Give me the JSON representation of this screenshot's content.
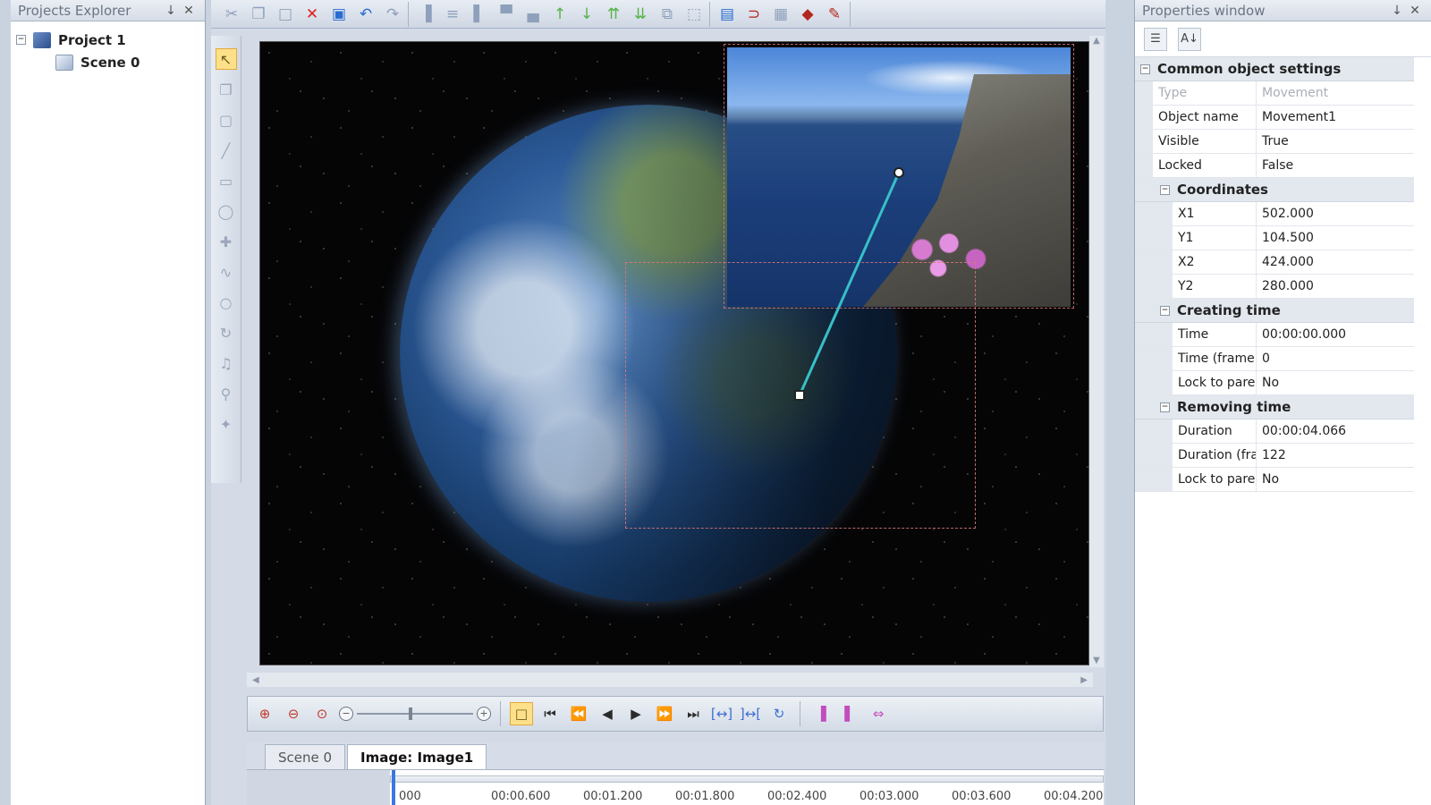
{
  "left_panel": {
    "title": "Projects Explorer",
    "pin": " ↓",
    "close": "✕",
    "tree": [
      {
        "label": "Project 1",
        "expander": "−"
      },
      {
        "label": "Scene 0"
      }
    ]
  },
  "toolbar": {
    "icons": [
      "cut-icon",
      "copy-icon",
      "paste-icon",
      "delete-icon",
      "fill-icon",
      "undo-icon",
      "redo-icon"
    ]
  },
  "tabs": [
    {
      "label": "Scene 0"
    },
    {
      "label": "Image: Image1"
    }
  ],
  "timeline": {
    "ticks": [
      "000",
      "00:00.600",
      "00:01.200",
      "00:01.800",
      "00:02.400",
      "00:03.000",
      "00:03.600",
      "00:04.200"
    ]
  },
  "right_panel": {
    "title": "Properties window",
    "pin": " ↓",
    "close": "✕",
    "categories": [
      {
        "name": "Common object settings",
        "rows": [
          {
            "name": "Type",
            "value": "Movement",
            "disabled": true
          },
          {
            "name": "Object name",
            "value": "Movement1"
          },
          {
            "name": "Visible",
            "value": "True"
          },
          {
            "name": "Locked",
            "value": "False"
          }
        ]
      },
      {
        "name": "Coordinates",
        "rows": [
          {
            "name": "X1",
            "value": "502.000"
          },
          {
            "name": "Y1",
            "value": "104.500"
          },
          {
            "name": "X2",
            "value": "424.000"
          },
          {
            "name": "Y2",
            "value": "280.000"
          }
        ]
      },
      {
        "name": "Creating time",
        "rows": [
          {
            "name": "Time",
            "value": "00:00:00.000"
          },
          {
            "name": "Time (frame)",
            "value": "0"
          },
          {
            "name": "Lock to parent",
            "value": "No"
          }
        ]
      },
      {
        "name": "Removing time",
        "rows": [
          {
            "name": "Duration",
            "value": "00:00:04.066"
          },
          {
            "name": "Duration (fram",
            "value": "122"
          },
          {
            "name": "Lock to parent",
            "value": "No"
          }
        ]
      }
    ]
  },
  "colors": {
    "accent_blue": "#3a78e0",
    "move_line": "#37c0c8",
    "selection": "#ffe08a"
  }
}
